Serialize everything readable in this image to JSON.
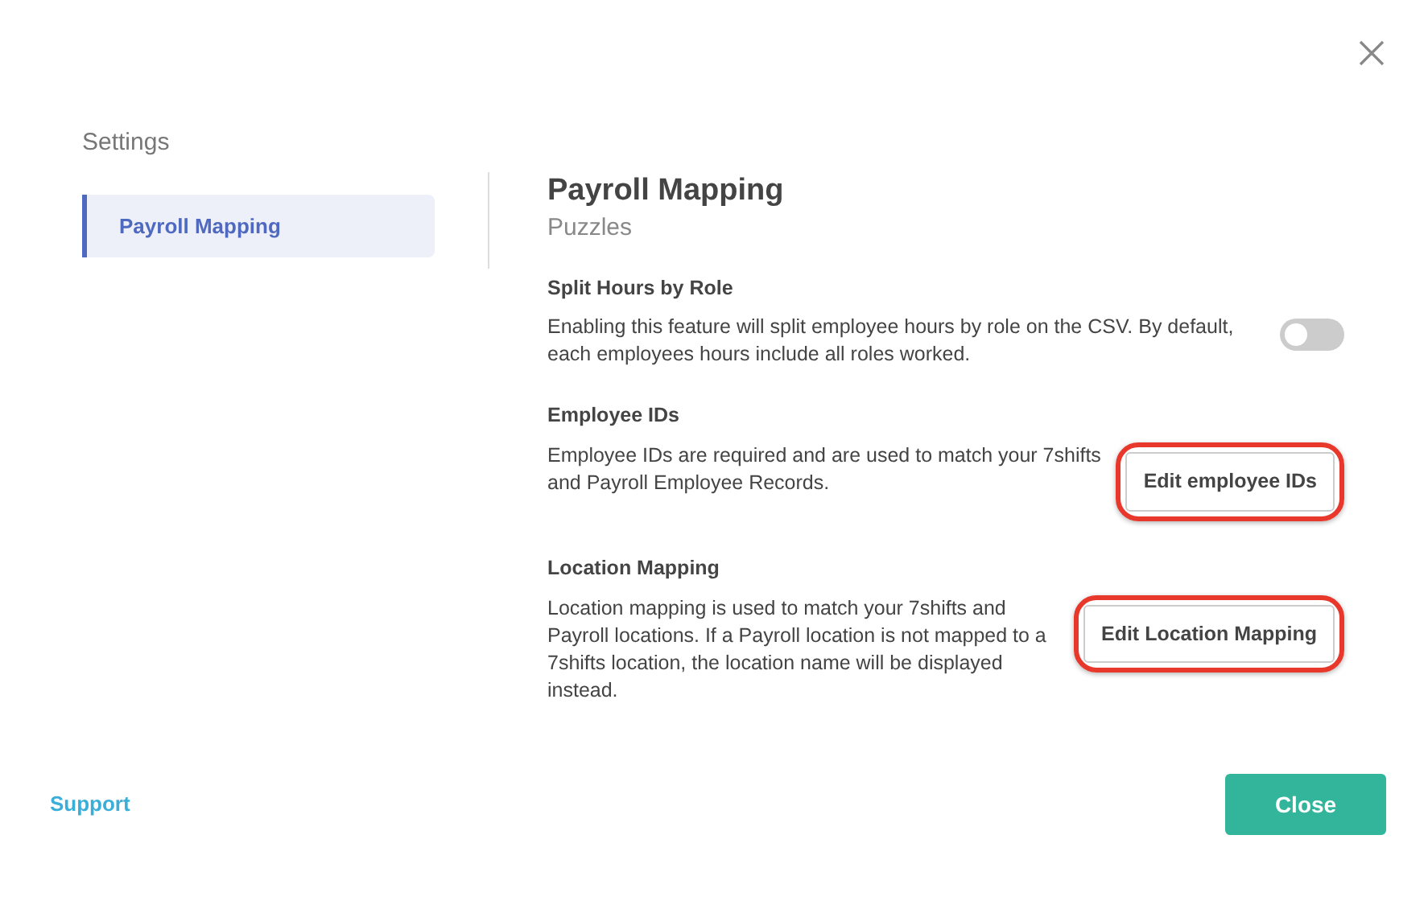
{
  "sidebar": {
    "title": "Settings",
    "items": [
      {
        "label": "Payroll Mapping",
        "selected": true
      }
    ]
  },
  "content": {
    "title": "Payroll Mapping",
    "subtitle": "Puzzles",
    "sections": [
      {
        "kind": "toggle",
        "title": "Split Hours by Role",
        "description": "Enabling this feature will split employee hours by role on the CSV. By default, each employees hours include all roles worked.",
        "on": false,
        "highlighted": false
      },
      {
        "kind": "button",
        "title": "Employee IDs",
        "description": "Employee IDs are required and are used to match your 7shifts and Payroll Employee Records.",
        "button": "Edit employee IDs",
        "highlighted": true
      },
      {
        "kind": "button",
        "title": "Location Mapping",
        "description": "Location mapping is used to match your 7shifts and Payroll locations. If a Payroll location is not mapped to a 7shifts location, the location name will be displayed instead.",
        "button": "Edit Location Mapping",
        "highlighted": true
      }
    ]
  },
  "footer": {
    "link": "Support",
    "button": "Close"
  }
}
